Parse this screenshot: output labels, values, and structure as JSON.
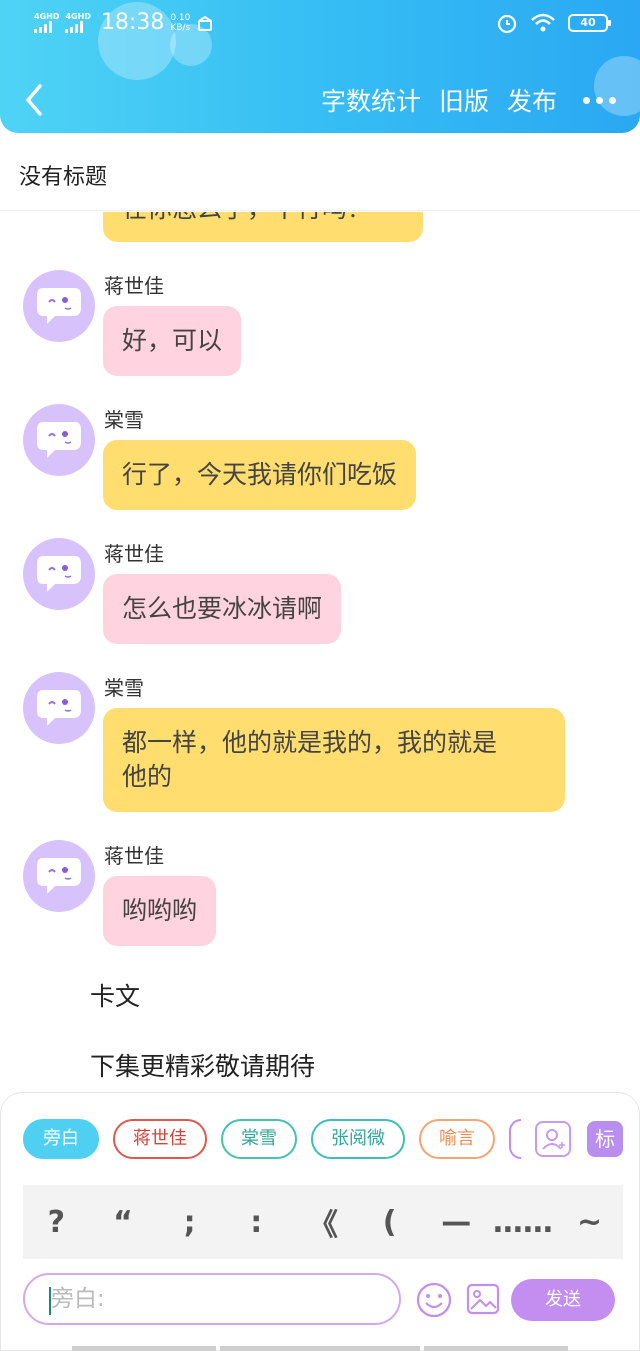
{
  "status_bar": {
    "signal1": "4GHD",
    "signal2": "4GHD",
    "time": "18:38",
    "speed_value": "0.10",
    "speed_unit": "KB/s",
    "battery": "40"
  },
  "nav": {
    "word_count": "字数统计",
    "old_version": "旧版",
    "publish": "发布"
  },
  "title": "没有标题",
  "messages": [
    {
      "speaker": "",
      "text": "在你怎么了，不行吗？",
      "color": "yellow"
    },
    {
      "speaker": "蒋世佳",
      "text": "好，可以",
      "color": "pink"
    },
    {
      "speaker": "棠雪",
      "text": "行了，今天我请你们吃饭",
      "color": "yellow"
    },
    {
      "speaker": "蒋世佳",
      "text": "怎么也要冰冰请啊",
      "color": "pink"
    },
    {
      "speaker": "棠雪",
      "line1": "都一样，他的就是我的，我的就是",
      "line2": "他的",
      "color": "yellow"
    },
    {
      "speaker": "蒋世佳",
      "text": "哟哟哟",
      "color": "pink"
    }
  ],
  "narration": [
    "卡文",
    "下集更精彩敬请期待"
  ],
  "roles": [
    "旁白",
    "蒋世佳",
    "棠雪",
    "张阅微",
    "喻言"
  ],
  "tag_button": "标",
  "punctuation": [
    "?",
    "“",
    ";",
    ":",
    "《",
    "(",
    "—",
    "……",
    "~"
  ],
  "input": {
    "placeholder": "旁白:"
  },
  "send_button": "发送",
  "colors": {
    "header": "#38c0f4",
    "yellow_bubble": "#ffdd6e",
    "pink_bubble": "#ffd3df",
    "avatar": "#d8c2fb",
    "send": "#c48df0"
  }
}
